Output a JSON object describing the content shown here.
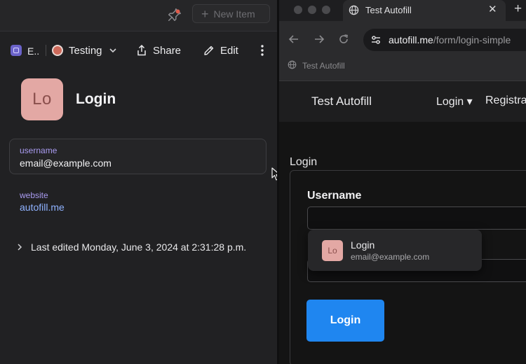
{
  "left_pane": {
    "topbar": {
      "new_item_label": "New Item",
      "pin_icon": "pin-icon"
    },
    "toolbar": {
      "vault_label": "E..",
      "tag_label": "Testing",
      "share_label": "Share",
      "edit_label": "Edit"
    },
    "item": {
      "avatar_text": "Lo",
      "title": "Login",
      "fields": {
        "username_label": "username",
        "username_value": "email@example.com",
        "website_label": "website",
        "website_value": "autofill.me"
      },
      "history_text": "Last edited Monday, June 3, 2024 at 2:31:28 p.m."
    },
    "colors": {
      "avatar_bg": "#e3a8a4",
      "field_label": "#a99bf0",
      "link": "#8fb2ff"
    }
  },
  "browser": {
    "tab": {
      "title": "Test Autofill",
      "close_glyph": "✕",
      "new_tab_glyph": "+"
    },
    "url": {
      "host": "autofill.me",
      "path": "/form/login-simple"
    },
    "bookmark": {
      "label": "Test Autofill"
    },
    "site": {
      "brand": "Test Autofill",
      "nav_login": "Login ▾",
      "nav_register": "Registra"
    },
    "form": {
      "heading": "Login",
      "username_label": "Username",
      "submit_label": "Login"
    },
    "autofill_suggestion": {
      "avatar_text": "Lo",
      "title": "Login",
      "subtitle": "email@example.com"
    },
    "colors": {
      "primary_button": "#1f86f0"
    }
  }
}
